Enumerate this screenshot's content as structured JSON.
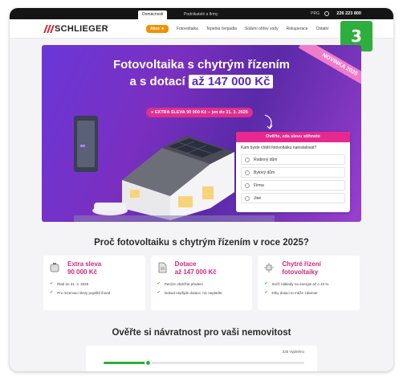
{
  "topbar": {
    "tabs": [
      "Domácnosti",
      "Podnikatelé a firmy"
    ],
    "lang": "PRG",
    "phone": "226 223 800"
  },
  "nav": {
    "logo": "SCHLIEGER",
    "akce": "Akce",
    "items": [
      "Fotovoltaika",
      "Tepelná čerpadla",
      "Solární ohřev vody",
      "Rekuperace",
      "Ostatní"
    ]
  },
  "badge": "3",
  "hero": {
    "title_line1": "Fotovoltaika s chytrým řízením",
    "title_line2_prefix": "a s dotací ",
    "title_line2_highlight": "až 147 000 Kč",
    "ribbon": "NOVINKA 2025",
    "sleva": "EXTRA SLEVA 90 000 Kč – jen do 31. 3. 2025"
  },
  "form": {
    "header": "Ověřte, zda slevu stihnete",
    "question": "Kam byste chtěli fotovoltaiku nainstalovat?",
    "options": [
      "Rodinný dům",
      "Bytový dům",
      "Firma",
      "Jiné"
    ]
  },
  "why": {
    "title": "Proč fotovoltaiku s chytrým řízením v roce 2025?",
    "cards": [
      {
        "icon": "piggy-bank-icon",
        "title_l1": "Extra sleva",
        "title_l2": "90 000 Kč",
        "lines": [
          "Platí do 31. 3. 2025",
          "Pro rezervaci slevy popiště ihned"
        ]
      },
      {
        "icon": "document-icon",
        "title_l1": "Dotace",
        "title_l2": "až 147 000 Kč",
        "lines": [
          "Peníze obdržíte předem",
          "Dokud nepřijde dotace, nic neplatíte"
        ]
      },
      {
        "icon": "chip-icon",
        "title_l1": "Chytré řízení",
        "title_l2": "fotovoltaiky",
        "lines": [
          "Sníží náklady na energie až o 43 %",
          "Díky dotaci to může zdarma!"
        ]
      }
    ]
  },
  "roi": {
    "title": "Ověřte si návratnost pro vaši nemovitost",
    "label": "235 Vyplněno",
    "progress": 0.22
  },
  "colors": {
    "accent_pink": "#e7288f",
    "brand_red": "#d9232e",
    "green": "#2eae3d",
    "hero_purple": "#6a37d8"
  }
}
